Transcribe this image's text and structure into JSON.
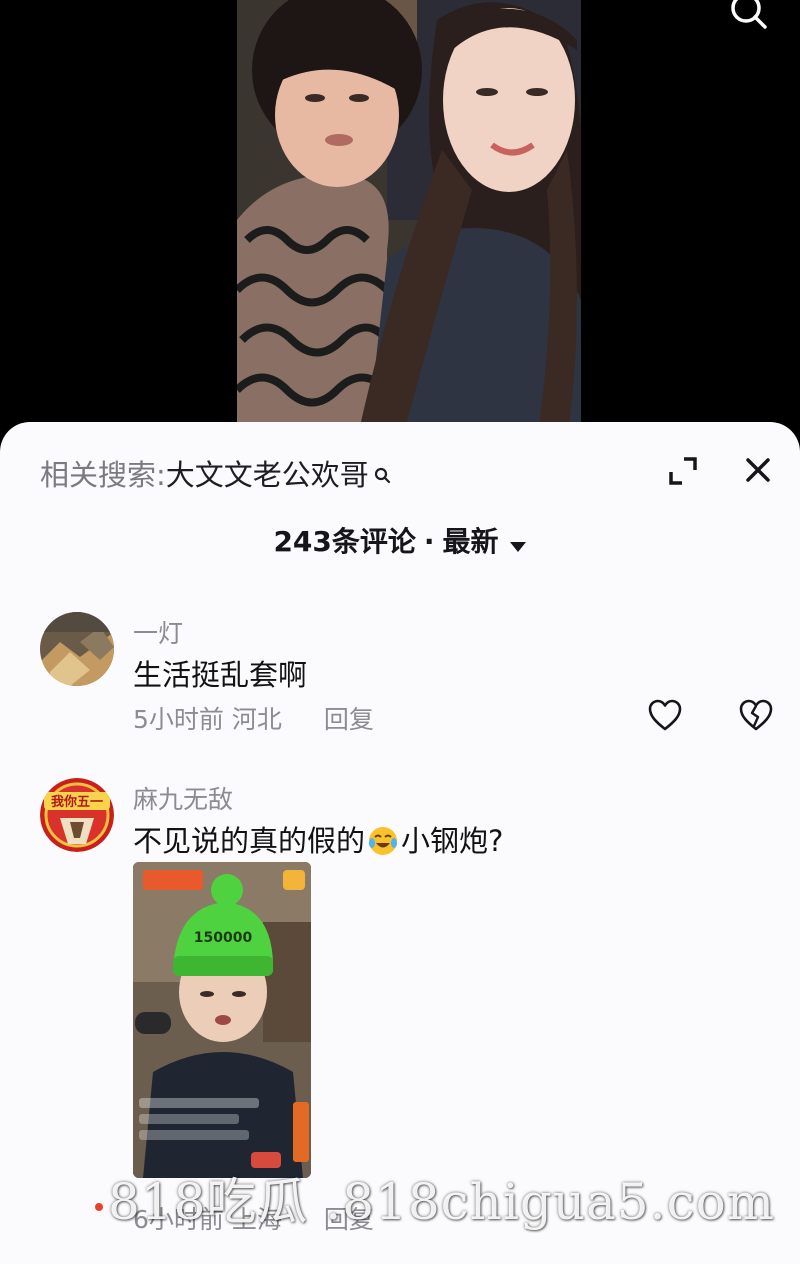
{
  "video": {
    "search_icon": "search-icon"
  },
  "sheet": {
    "related_prefix": "相关搜索:",
    "related_keyword": "大文文老公欢哥",
    "count_label": "243条评论",
    "separator": "·",
    "sort_label": "最新",
    "icons": [
      "search-icon",
      "expand-icon",
      "close-icon",
      "sort-down-icon"
    ]
  },
  "comments": [
    {
      "username": "一灯",
      "text": "生活挺乱套啊",
      "time": "5小时前",
      "location": "河北",
      "reply_label": "回复",
      "icons": [
        "heart-icon",
        "dislike-icon"
      ]
    },
    {
      "username": "麻九无敌",
      "text_before": "不见说的真的假的",
      "emoji": "laughing-crying-emoji",
      "text_after": "小钢炮?",
      "avatar_text": "我你五一",
      "image_texts": [
        "150000"
      ],
      "time": "6小时前",
      "location": "上海",
      "reply_label": "回复"
    }
  ],
  "watermark": "818吃瓜 .818chigua5.com",
  "colors": {
    "sheet_bg": "#fbfbfd",
    "primary_text": "#121214",
    "secondary_text": "#8c8c92",
    "watermark_dot": "#e8422c"
  }
}
